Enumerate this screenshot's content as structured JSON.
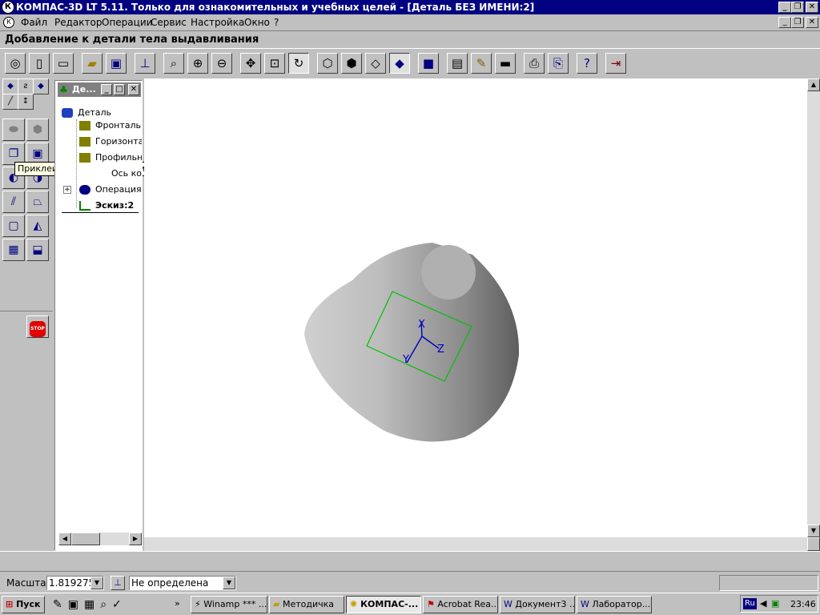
{
  "window": {
    "title": "КОМПАС-3D LT 5.11. Только для ознакомительных и учебных целей - [Деталь БЕЗ ИМЕНИ:2]"
  },
  "menu": [
    "Файл",
    "Редактор",
    "Операции",
    "Сервис",
    "Настройка",
    "Окно",
    "?"
  ],
  "command_title": "Добавление к детали тела выдавливания",
  "toolbar_icons": [
    "measure-icon",
    "new-doc-icon",
    "new-sheet-icon",
    "open-folder-icon",
    "save-icon",
    "sketch-icon",
    "zoom-icon",
    "zoom-in-icon",
    "zoom-out-icon",
    "pan-icon",
    "fit-icon",
    "rotate-icon",
    "wireframe-icon",
    "hidden-lines-icon",
    "thin-lines-icon",
    "shaded-icon",
    "perspective-icon",
    "spec-icon",
    "properties-icon",
    "drawing-icon",
    "preview-icon",
    "print-icon",
    "help-icon",
    "exit-icon"
  ],
  "tooltip": "Приклеить выдавливанием",
  "tree": {
    "title": "Де...",
    "items": [
      "Деталь",
      "Фронталь",
      "Горизонта",
      "Профильн",
      "Ось ко",
      "Операция",
      "Эскиз:2"
    ]
  },
  "model": {
    "axis_x": "X",
    "axis_y": "Y",
    "axis_z": "Z"
  },
  "statusbar": {
    "scale_label": "Масштаб",
    "scale_value": "1.819275",
    "orientation_value": "Не определена"
  },
  "taskbar": {
    "start": "Пуск",
    "tasks": [
      "Winamp *** ...",
      "Методичка",
      "КОМПАС-...",
      "Acrobat Rea...",
      "Документ3 ...",
      "Лаборатор..."
    ],
    "lang": "Ru",
    "clock": "23:46"
  }
}
